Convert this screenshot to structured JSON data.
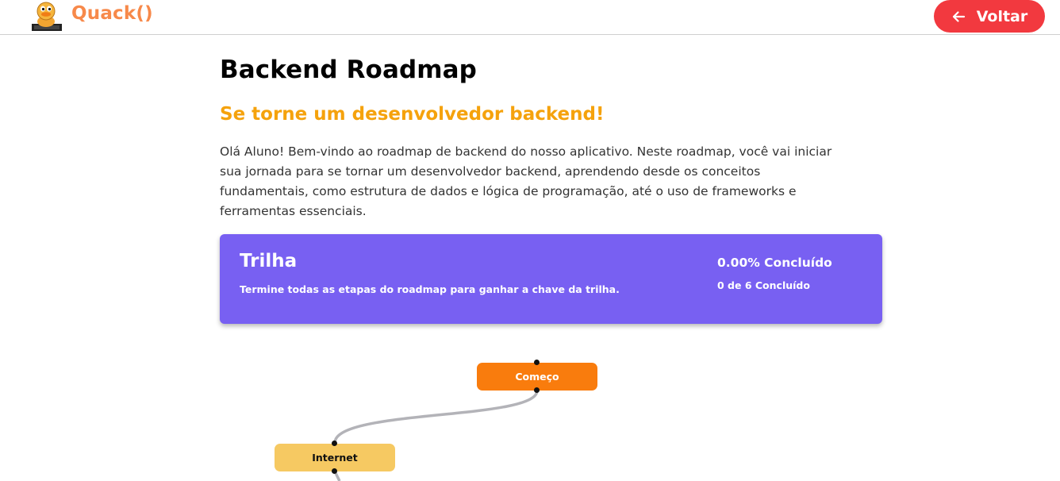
{
  "header": {
    "logo_icon": "duck-mascot-logo",
    "brand": "Quack()",
    "back_button": {
      "label": "Voltar",
      "icon": "arrow-left-icon",
      "color": "#f2393f"
    }
  },
  "main": {
    "title": "Backend Roadmap",
    "subtitle": "Se torne um desenvolvedor backend!",
    "intro": "Olá Aluno! Bem-vindo ao roadmap de backend do nosso aplicativo. Neste roadmap, você vai iniciar sua jornada para se tornar um desenvolvedor backend, aprendendo desde os conceitos fundamentais, como estrutura de dados e lógica de programação, até o uso de frameworks e ferramentas essenciais."
  },
  "track": {
    "title": "Trilha",
    "description": "Termine todas as etapas do roadmap para ganhar a chave da trilha.",
    "percent": "0.00% Concluído",
    "count": "0 de 6 Concluído",
    "progress_fraction": 0,
    "color": "#7860f2"
  },
  "roadmap": {
    "nodes": [
      {
        "label": "Começo",
        "color": "#f97c0d"
      },
      {
        "label": "Internet",
        "color": "#f6c962"
      }
    ],
    "edge_color": "#b3b3b8"
  },
  "colors": {
    "brand": "#f7894a",
    "subtitle": "#f5a20c"
  }
}
